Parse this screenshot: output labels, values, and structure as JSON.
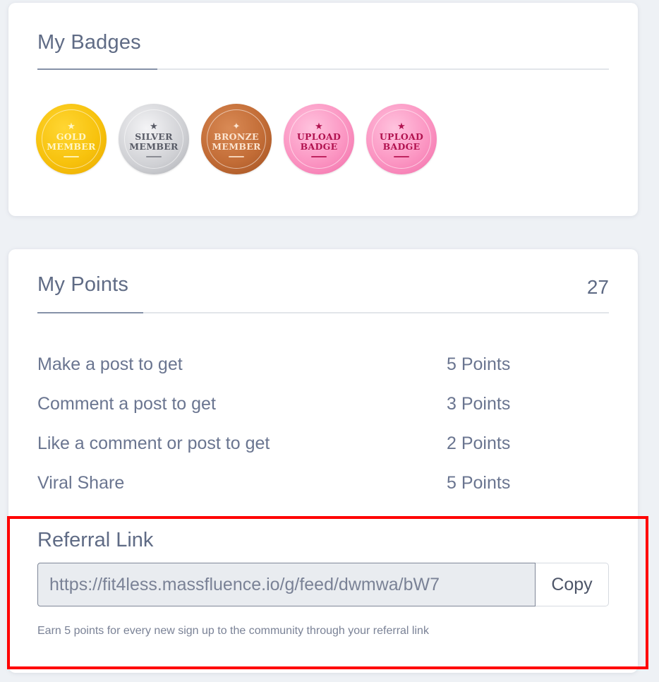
{
  "badges_card": {
    "title": "My Badges",
    "badges": [
      {
        "name": "gold-member",
        "line1": "GOLD",
        "line2": "MEMBER",
        "star": "★",
        "color": "#f7c20d"
      },
      {
        "name": "silver-member",
        "line1": "SILVER",
        "line2": "MEMBER",
        "star": "★",
        "color": "#cfd0d4"
      },
      {
        "name": "bronze-member",
        "line1": "BRONZE",
        "line2": "MEMBER",
        "star": "✦",
        "color": "#c26c36"
      },
      {
        "name": "upload-badge",
        "line1": "UPLOAD",
        "line2": "BADGE",
        "star": "★",
        "color": "#fb95c2"
      },
      {
        "name": "upload-badge",
        "line1": "UPLOAD",
        "line2": "BADGE",
        "star": "★",
        "color": "#fb95c2"
      }
    ]
  },
  "points_card": {
    "title": "My Points",
    "total": "27",
    "rows": [
      {
        "label": "Make a post to get",
        "value": "5 Points"
      },
      {
        "label": "Comment a post to get",
        "value": "3 Points"
      },
      {
        "label": "Like a comment or post to get",
        "value": "2 Points"
      },
      {
        "label": "Viral Share",
        "value": "5 Points"
      }
    ],
    "referral": {
      "title": "Referral Link",
      "link": "https://fit4less.massfluence.io/g/feed/dwmwa/bW7",
      "copy_label": "Copy",
      "help_text": "Earn 5 points for every new sign up to the community through your referral link"
    }
  },
  "colors": {
    "highlight": "#ff0000",
    "page_background": "#eef1f5",
    "text_primary": "#5f6b85"
  }
}
